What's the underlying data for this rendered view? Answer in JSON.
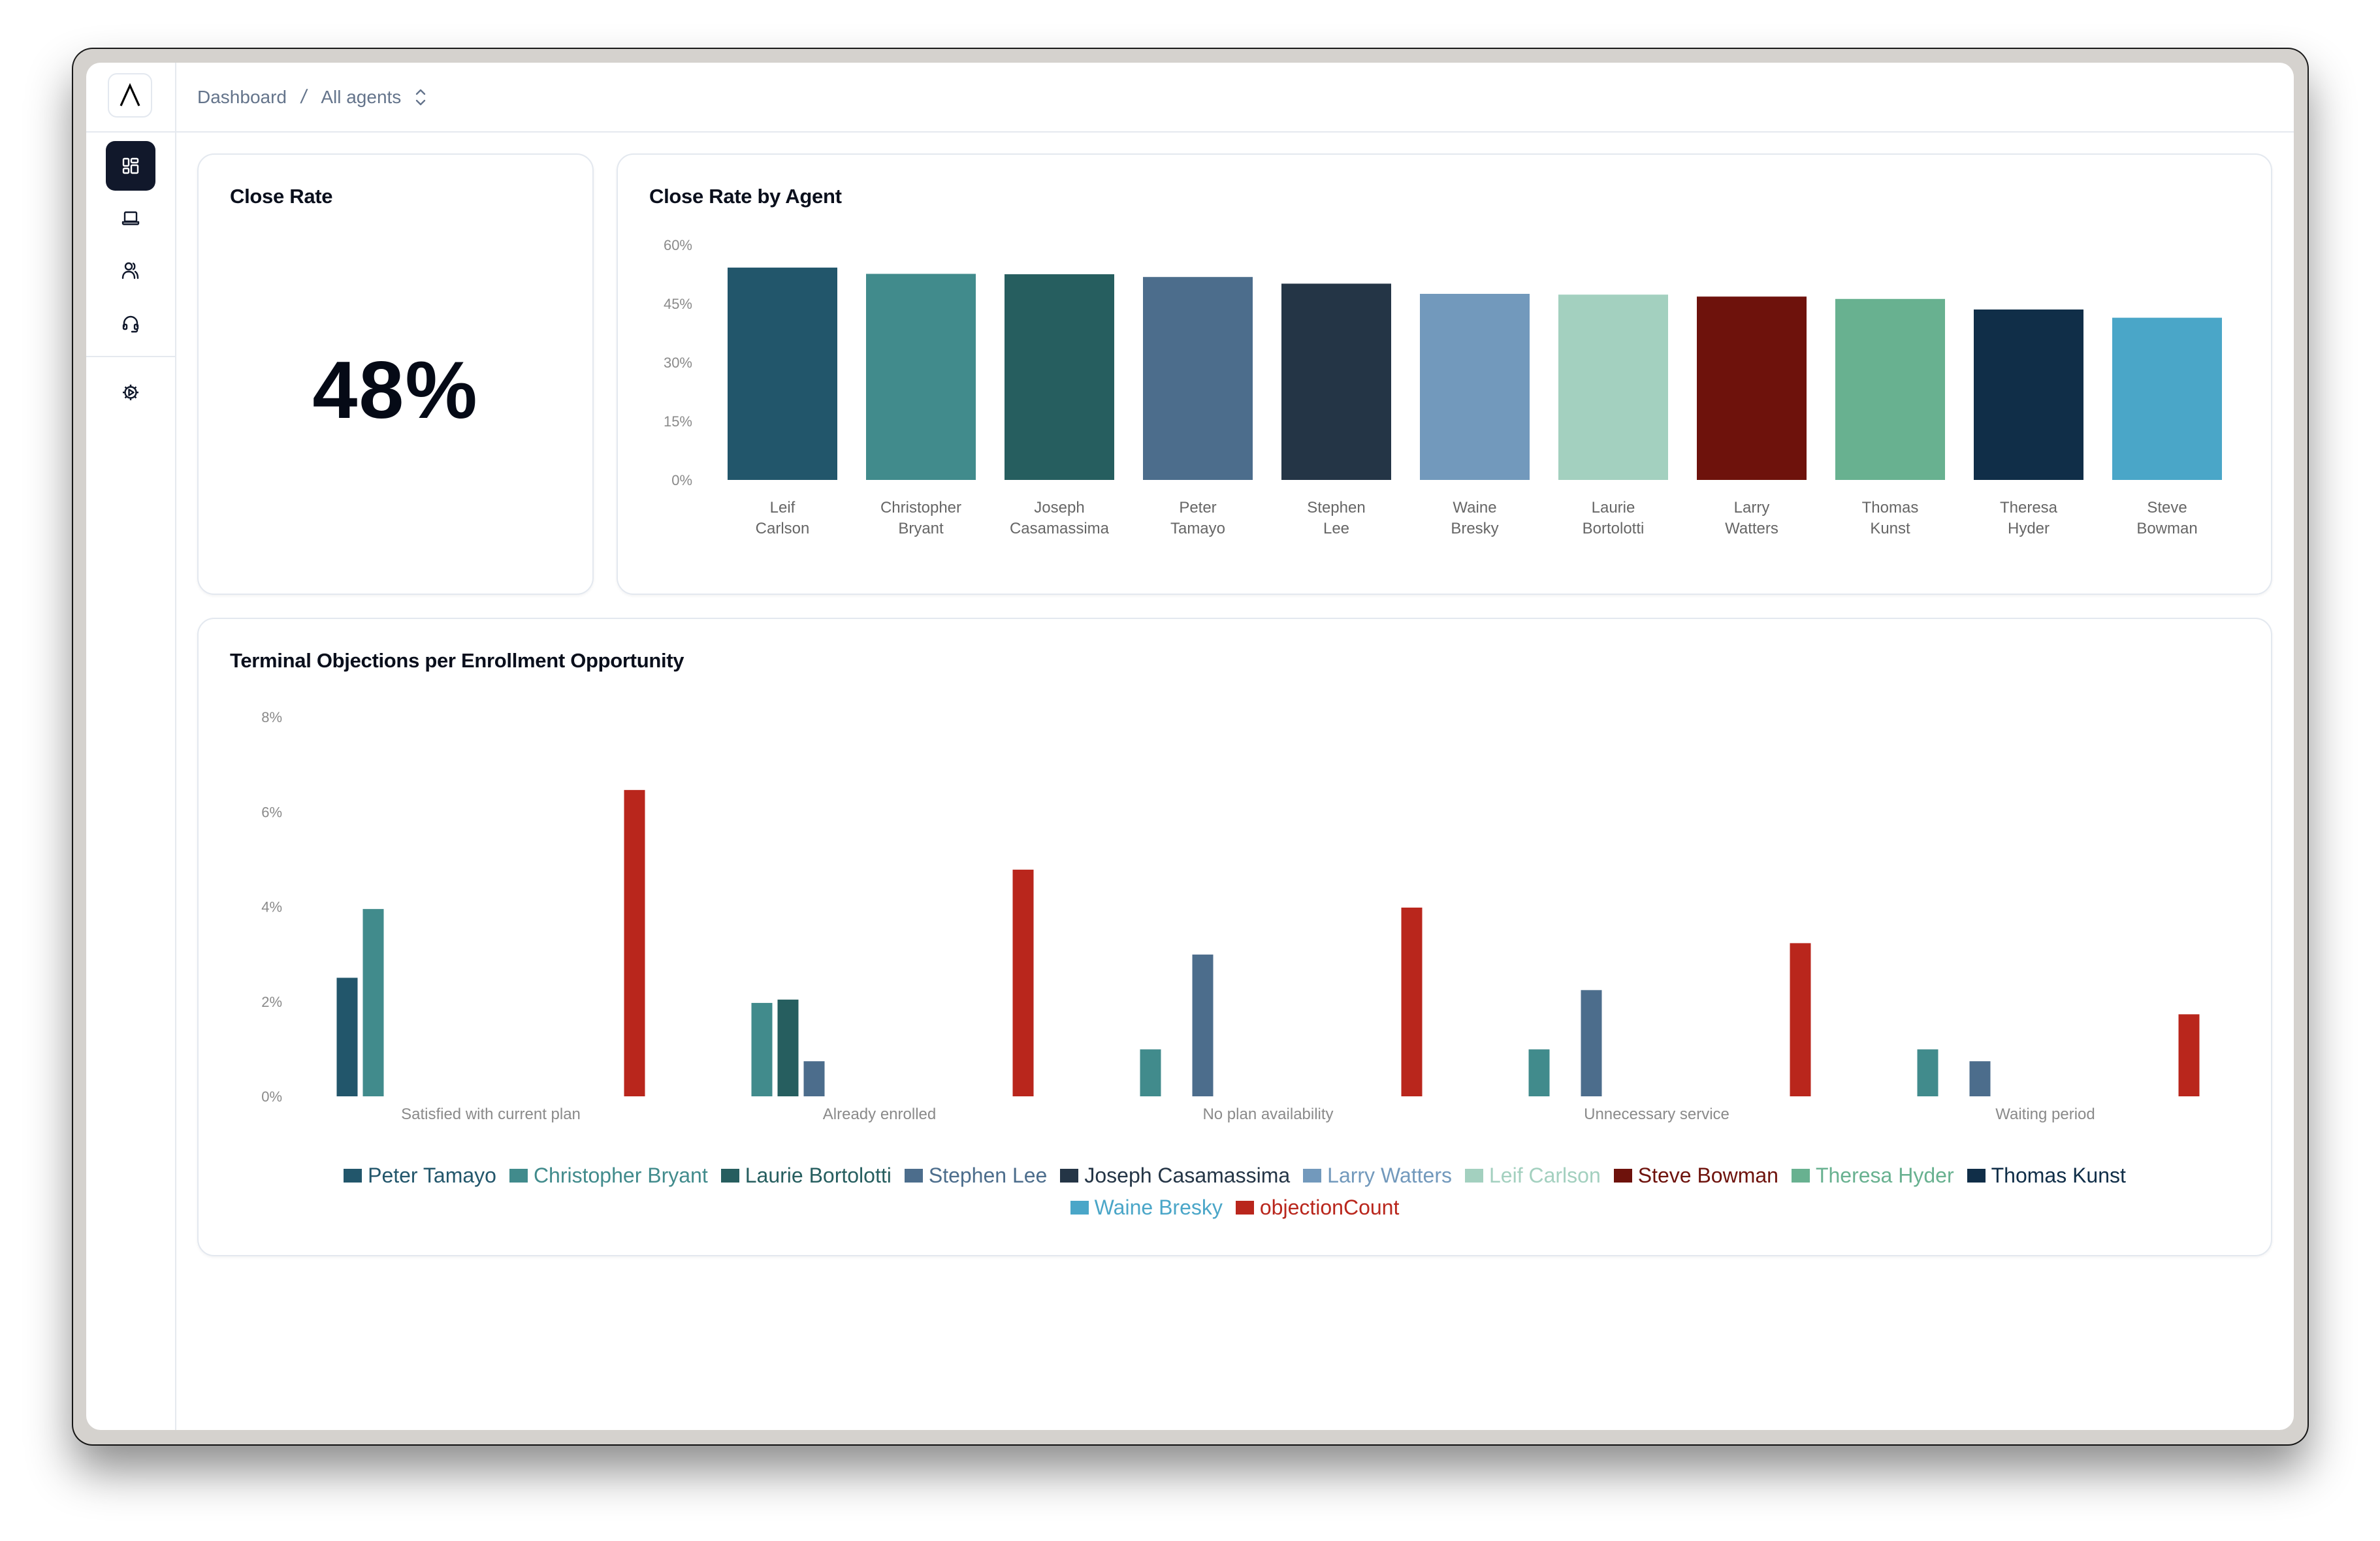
{
  "header": {
    "breadcrumb": [
      "Dashboard",
      "All agents"
    ],
    "separator": "/",
    "selector_icon": "chevron-up-down-icon"
  },
  "sidebar": {
    "logo_icon": "lambda-logo-icon",
    "items": [
      {
        "name": "dashboard",
        "icon": "dashboard-grid-icon",
        "active": true
      },
      {
        "name": "devices",
        "icon": "laptop-icon",
        "active": false
      },
      {
        "name": "agents",
        "icon": "users-icon",
        "active": false
      },
      {
        "name": "support",
        "icon": "headset-icon",
        "active": false
      },
      {
        "name": "settings",
        "icon": "gear-icon",
        "active": false
      }
    ]
  },
  "kpi_card": {
    "title": "Close Rate",
    "value": "48%"
  },
  "chart_data": [
    {
      "type": "bar",
      "title": "Close Rate by Agent",
      "xlabel": "",
      "ylabel": "",
      "ylim": [
        0,
        60
      ],
      "yticks": [
        "0%",
        "15%",
        "30%",
        "45%",
        "60%"
      ],
      "ytick_values": [
        0,
        15,
        30,
        45,
        60
      ],
      "grid": false,
      "legend": "none",
      "categories": [
        [
          "Leif",
          "Carlson"
        ],
        [
          "Christopher",
          "Bryant"
        ],
        [
          "Joseph",
          "Casamassima"
        ],
        [
          "Peter",
          "Tamayo"
        ],
        [
          "Stephen",
          "Lee"
        ],
        [
          "Waine",
          "Bresky"
        ],
        [
          "Laurie",
          "Bortolotti"
        ],
        [
          "Larry",
          "Watters"
        ],
        [
          "Thomas",
          "Kunst"
        ],
        [
          "Theresa",
          "Hyder"
        ],
        [
          "Steve",
          "Bowman"
        ]
      ],
      "values": [
        54.2,
        52.6,
        52.5,
        51.8,
        50.1,
        47.5,
        47.3,
        46.8,
        46.2,
        43.5,
        41.4
      ],
      "colors": [
        "#22566b",
        "#418b8c",
        "#265e5f",
        "#4c6d8c",
        "#243546",
        "#7299bc",
        "#a3d0bf",
        "#6e120c",
        "#68b190",
        "#102e48",
        "#4aa6c8"
      ]
    },
    {
      "type": "bar",
      "title": "Terminal Objections per Enrollment Opportunity",
      "xlabel": "",
      "ylabel": "",
      "ylim": [
        0,
        8
      ],
      "yticks": [
        "0%",
        "2%",
        "4%",
        "6%",
        "8%"
      ],
      "ytick_values": [
        0,
        2,
        4,
        6,
        8
      ],
      "grid": false,
      "legend": "bottom",
      "categories": [
        "Satisfied with current plan",
        "Already enrolled",
        "No plan availability",
        "Unnecessary service",
        "Waiting period"
      ],
      "series": [
        {
          "name": "Peter Tamayo",
          "color": "#22566b",
          "values": [
            2.5,
            0,
            0,
            0,
            0
          ]
        },
        {
          "name": "Christopher Bryant",
          "color": "#418b8c",
          "values": [
            3.95,
            1.97,
            0.99,
            0.99,
            0.99
          ]
        },
        {
          "name": "Laurie Bortolotti",
          "color": "#265e5f",
          "values": [
            0,
            2.04,
            0,
            0,
            0
          ]
        },
        {
          "name": "Stephen Lee",
          "color": "#4c6d8c",
          "values": [
            0,
            0.74,
            2.99,
            2.24,
            0.74
          ]
        },
        {
          "name": "Joseph Casamassima",
          "color": "#243546",
          "values": [
            0,
            0,
            0,
            0,
            0
          ]
        },
        {
          "name": "Larry Watters",
          "color": "#7299bc",
          "values": [
            0,
            0,
            0,
            0,
            0
          ]
        },
        {
          "name": "Leif Carlson",
          "color": "#a3d0bf",
          "values": [
            0,
            0,
            0,
            0,
            0
          ]
        },
        {
          "name": "Steve Bowman",
          "color": "#6e120c",
          "values": [
            0,
            0,
            0,
            0,
            0
          ]
        },
        {
          "name": "Theresa Hyder",
          "color": "#68b190",
          "values": [
            0,
            0,
            0,
            0,
            0
          ]
        },
        {
          "name": "Thomas Kunst",
          "color": "#102e48",
          "values": [
            0,
            0,
            0,
            0,
            0
          ]
        },
        {
          "name": "Waine Bresky",
          "color": "#4aa6c8",
          "values": [
            0,
            0,
            0,
            0,
            0
          ]
        },
        {
          "name": "objectionCount",
          "color": "#b9261c",
          "values": [
            6.46,
            4.78,
            3.98,
            3.23,
            1.73
          ]
        }
      ]
    }
  ]
}
